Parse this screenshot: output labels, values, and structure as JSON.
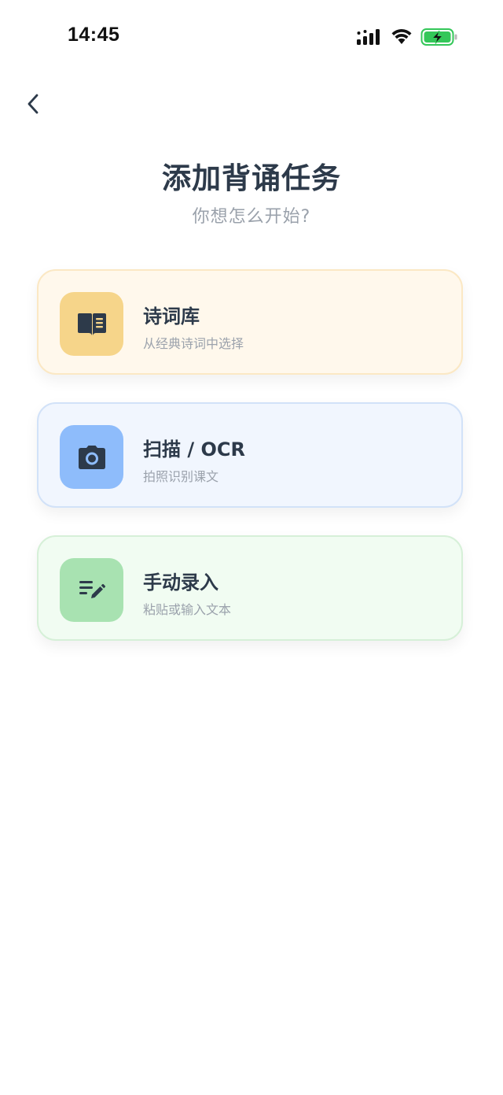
{
  "status_bar": {
    "time": "14:45",
    "icons": [
      "signal-icon",
      "wifi-icon",
      "battery-charging-icon"
    ]
  },
  "nav": {
    "back_icon": "chevron-left-icon"
  },
  "header": {
    "title": "添加背诵任务",
    "subtitle": "你想怎么开始?"
  },
  "options": [
    {
      "title": "诗词库",
      "description": "从经典诗词中选择",
      "icon": "book-icon",
      "icon_bg": "#f6d58a",
      "card_bg": "#fff8ec"
    },
    {
      "title": "扫描 / OCR",
      "description": "拍照识别课文",
      "icon": "camera-icon",
      "icon_bg": "#8ebcfb",
      "card_bg": "#f1f6fe"
    },
    {
      "title": "手动录入",
      "description": "粘贴或输入文本",
      "icon": "edit-list-icon",
      "icon_bg": "#a8e2b1",
      "card_bg": "#f1fcf2"
    }
  ],
  "colors": {
    "text_primary": "#2d3a4a",
    "text_secondary": "#9aa1ab",
    "battery_green": "#34c759"
  }
}
